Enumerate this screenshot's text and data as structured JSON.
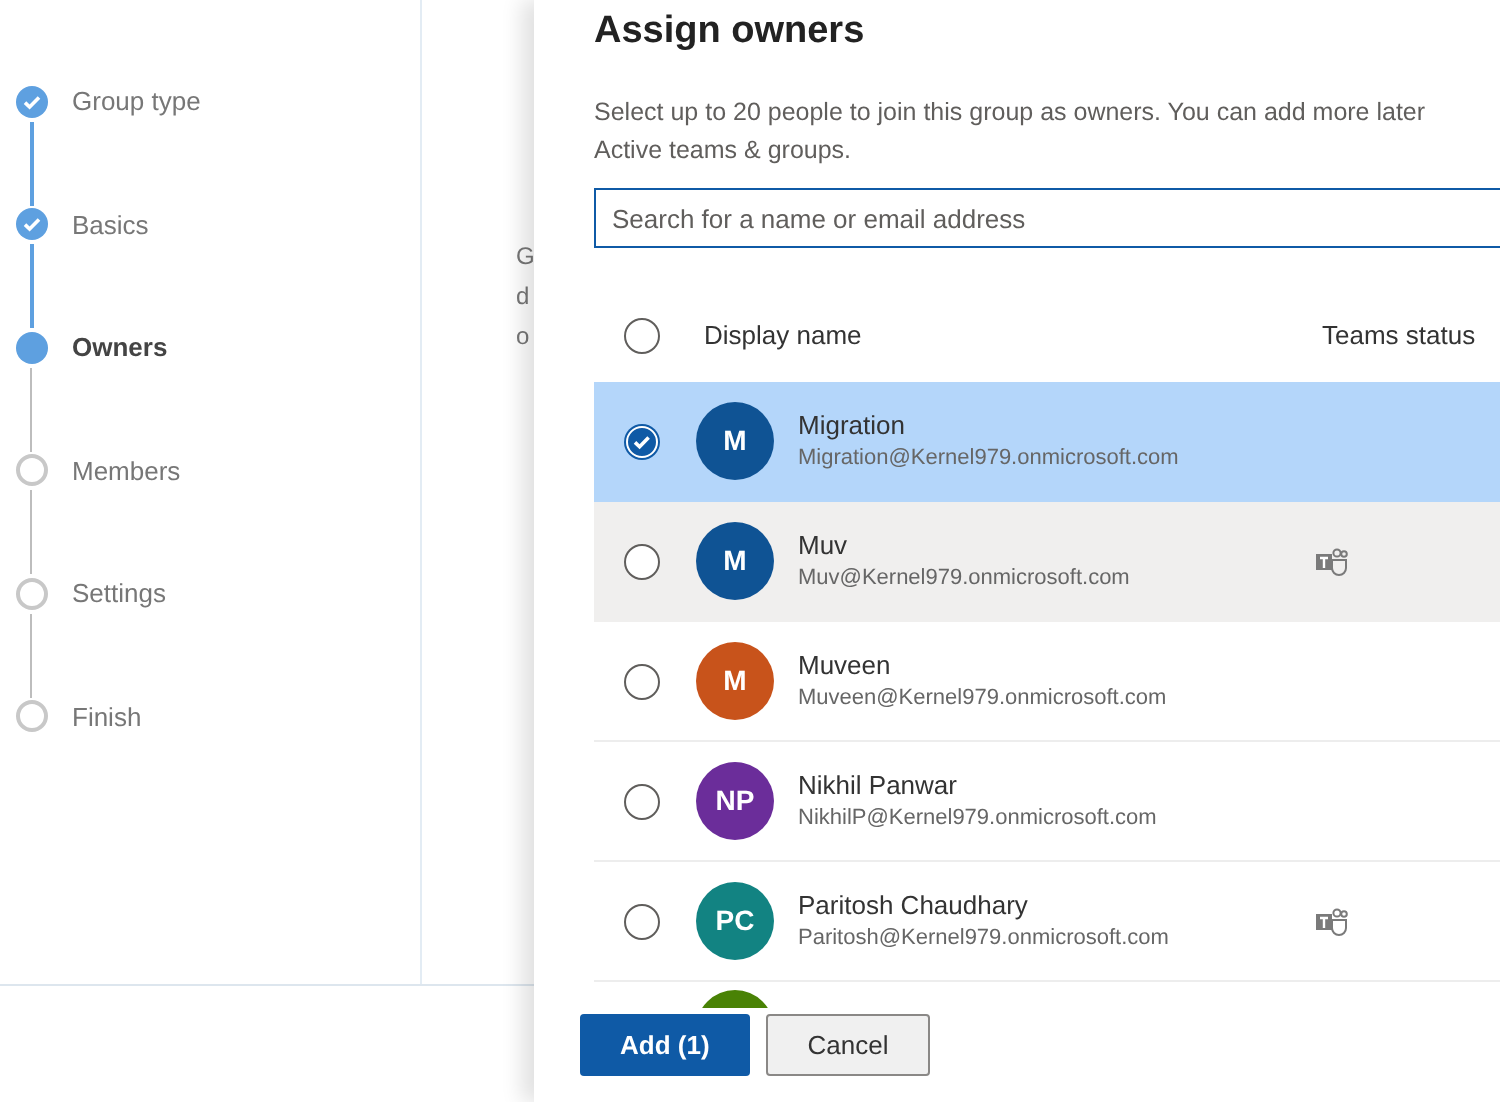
{
  "steps": [
    {
      "label": "Group type",
      "kind": "done"
    },
    {
      "label": "Basics",
      "kind": "done"
    },
    {
      "label": "Owners",
      "kind": "current"
    },
    {
      "label": "Members",
      "kind": "pending"
    },
    {
      "label": "Settings",
      "kind": "pending"
    },
    {
      "label": "Finish",
      "kind": "pending"
    }
  ],
  "background_page": {
    "text_lines": [
      "G",
      "d",
      "o"
    ]
  },
  "panel": {
    "title": "Assign owners",
    "description": "Select up to 20 people to join this group as owners. You can add more later",
    "description_line_2": "Active teams & groups.",
    "search": {
      "placeholder": "Search for a name or email address"
    },
    "columns": [
      {
        "label": "Display name"
      },
      {
        "label": "Teams status"
      }
    ],
    "select_all": {
      "checked": false
    },
    "rows": [
      {
        "initials": "M",
        "color": "#0f5394",
        "name": "Migration",
        "email": "Migration@Kernel979.onmicrosoft.com",
        "selected": true,
        "hovered": false,
        "teams": false
      },
      {
        "initials": "M",
        "color": "#0f5394",
        "name": "Muv",
        "email": "Muv@Kernel979.onmicrosoft.com",
        "selected": false,
        "hovered": true,
        "teams": true
      },
      {
        "initials": "M",
        "color": "#c8531b",
        "name": "Muveen",
        "email": "Muveen@Kernel979.onmicrosoft.com",
        "selected": false,
        "hovered": false,
        "teams": false
      },
      {
        "initials": "NP",
        "color": "#6b2d9a",
        "name": "Nikhil Panwar",
        "email": "NikhilP@Kernel979.onmicrosoft.com",
        "selected": false,
        "hovered": false,
        "teams": false
      },
      {
        "initials": "PC",
        "color": "#128382",
        "name": "Paritosh Chaudhary",
        "email": "Paritosh@Kernel979.onmicrosoft.com",
        "selected": false,
        "hovered": false,
        "teams": true
      }
    ],
    "partial_row": {
      "color": "#498205"
    },
    "buttons": [
      {
        "label": "Add (1)",
        "kind": "primary"
      },
      {
        "label": "Cancel",
        "kind": "secondary"
      }
    ]
  }
}
